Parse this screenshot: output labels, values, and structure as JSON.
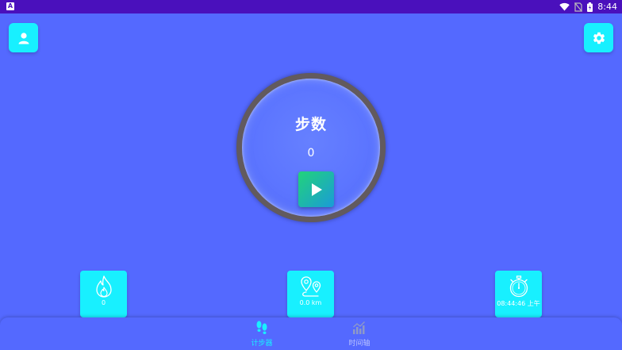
{
  "status_bar": {
    "time": "8:44",
    "app_indicator": "A"
  },
  "header": {
    "profile_icon": "person-icon",
    "settings_icon": "gear-icon"
  },
  "dial": {
    "title": "步数",
    "count": "0",
    "play_icon": "play-icon"
  },
  "stats": {
    "calories": {
      "icon": "flame-icon",
      "value": "0"
    },
    "distance": {
      "icon": "map-pin-icon",
      "value": "0.0 km"
    },
    "time": {
      "icon": "stopwatch-icon",
      "value": "08:44:46 上午"
    }
  },
  "nav": {
    "items": [
      {
        "label": "计步器",
        "icon": "footprints-icon",
        "active": true
      },
      {
        "label": "时间轴",
        "icon": "bar-chart-icon",
        "active": false
      }
    ]
  },
  "colors": {
    "background": "#5469FF",
    "accent": "#18F0FF",
    "status_bar": "#4A10BC"
  }
}
